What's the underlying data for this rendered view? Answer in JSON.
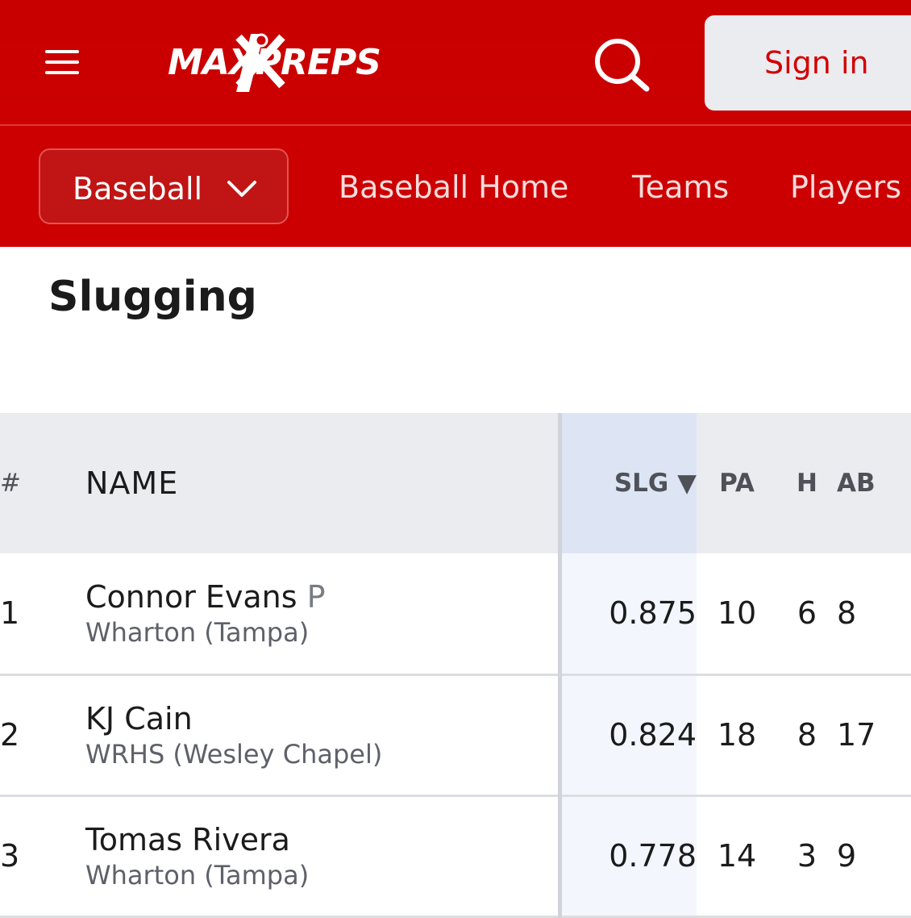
{
  "header": {
    "logo_text": "MAXPREPS",
    "signin_label": "Sign in",
    "colors": {
      "brand_red": "#cc0000",
      "signin_bg": "#ebecf0"
    }
  },
  "subnav": {
    "sport": "Baseball",
    "links": [
      "Baseball Home",
      "Teams",
      "Players"
    ]
  },
  "page": {
    "title": "Slugging"
  },
  "table": {
    "columns": {
      "rank": "#",
      "name": "NAME",
      "slg": "SLG ▼",
      "pa": "PA",
      "h": "H",
      "ab": "AB"
    },
    "rows": [
      {
        "rank": "1",
        "name": "Connor Evans",
        "pos": "P",
        "school": "Wharton (Tampa)",
        "slg": "0.875",
        "pa": "10",
        "h": "6",
        "ab": "8"
      },
      {
        "rank": "2",
        "name": "KJ Cain",
        "pos": "",
        "school": "WRHS (Wesley Chapel)",
        "slg": "0.824",
        "pa": "18",
        "h": "8",
        "ab": "17"
      },
      {
        "rank": "3",
        "name": "Tomas Rivera",
        "pos": "",
        "school": "Wharton (Tampa)",
        "slg": "0.778",
        "pa": "14",
        "h": "3",
        "ab": "9"
      }
    ]
  }
}
